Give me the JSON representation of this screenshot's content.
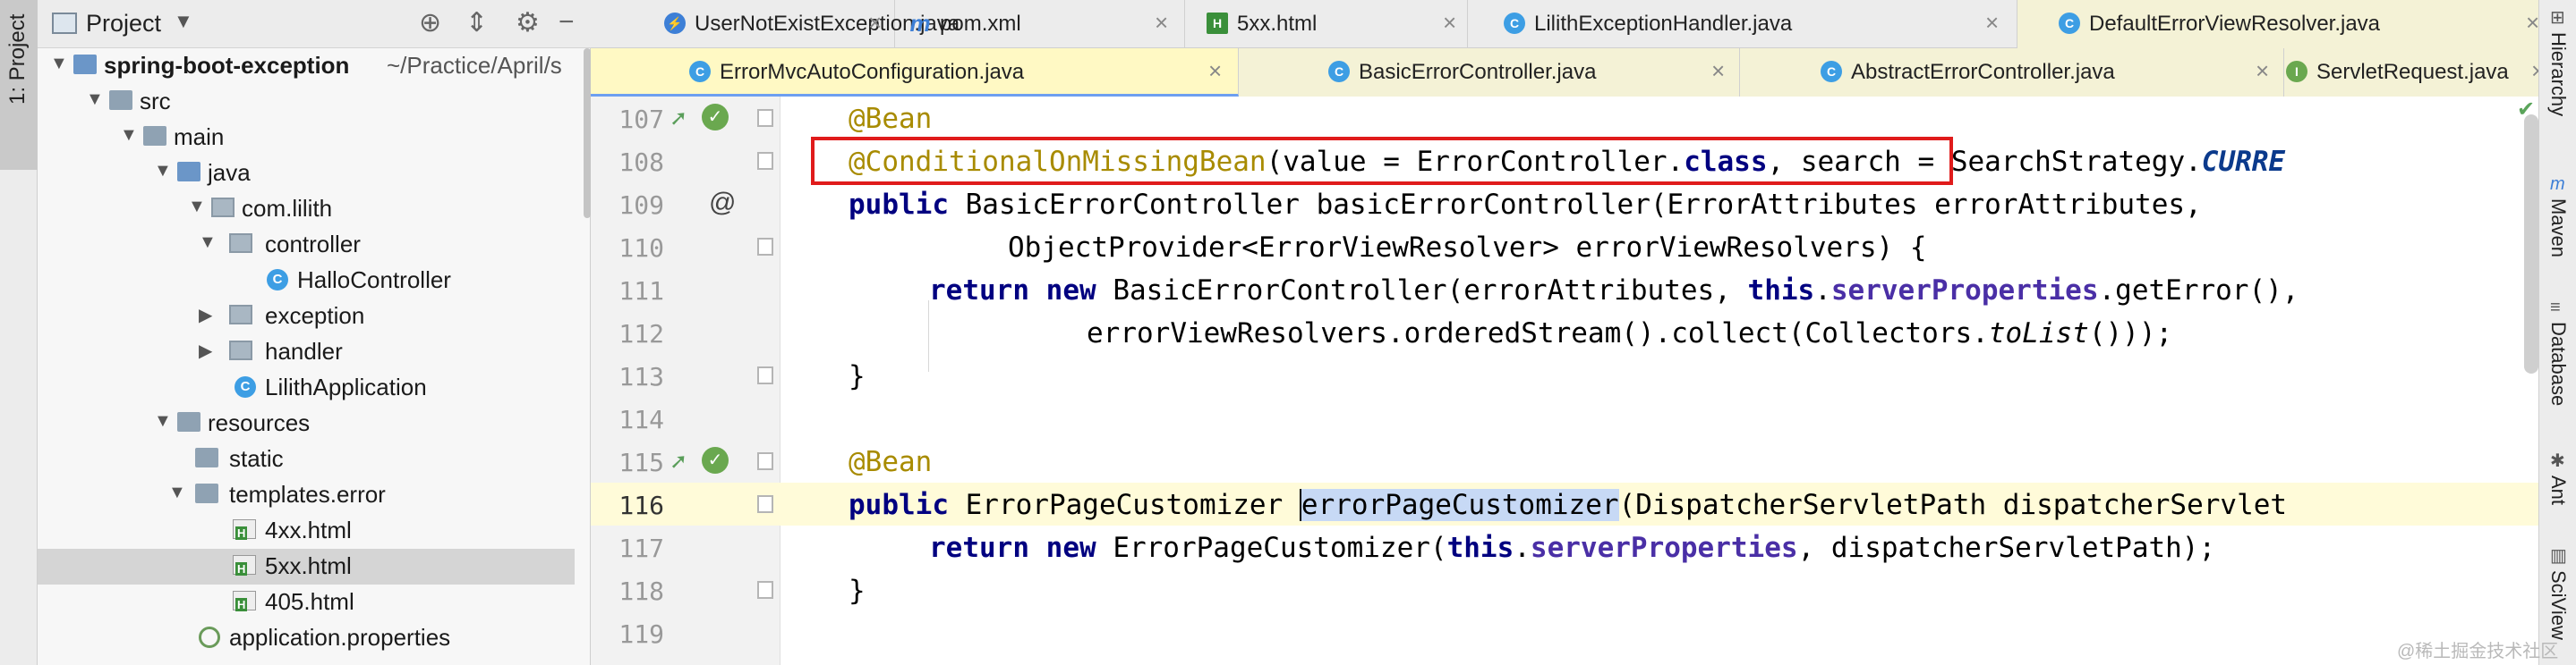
{
  "left_stripe": {
    "tab_label": "1: Project"
  },
  "project_panel": {
    "title": "Project",
    "tree": [
      {
        "label": "spring-boot-exception",
        "suffix": " ~/Practice/April/s",
        "bold": true
      },
      {
        "label": "src"
      },
      {
        "label": "main"
      },
      {
        "label": "java"
      },
      {
        "label": "com.lilith"
      },
      {
        "label": "controller"
      },
      {
        "label": "HalloController"
      },
      {
        "label": "exception"
      },
      {
        "label": "handler"
      },
      {
        "label": "LilithApplication"
      },
      {
        "label": "resources"
      },
      {
        "label": "static"
      },
      {
        "label": "templates.error"
      },
      {
        "label": "4xx.html"
      },
      {
        "label": "5xx.html"
      },
      {
        "label": "405.html"
      },
      {
        "label": "application.properties"
      }
    ]
  },
  "tabs_row1": [
    {
      "label": "UserNotExistException.java"
    },
    {
      "label": "pom.xml"
    },
    {
      "label": "5xx.html"
    },
    {
      "label": "LilithExceptionHandler.java"
    },
    {
      "label": "DefaultErrorViewResolver.java"
    }
  ],
  "tabs_row2": [
    {
      "label": "ErrorMvcAutoConfiguration.java"
    },
    {
      "label": "BasicErrorController.java"
    },
    {
      "label": "AbstractErrorController.java"
    },
    {
      "label": "ServletRequest.java"
    }
  ],
  "editor": {
    "line_numbers": [
      "107",
      "108",
      "109",
      "110",
      "111",
      "112",
      "113",
      "114",
      "115",
      "116",
      "117",
      "118",
      "119"
    ],
    "code": {
      "l107_ann": "@Bean",
      "l108_ann": "@ConditionalOnMissingBean",
      "l108_a": "(value = ErrorController.",
      "l108_kw": "class",
      "l108_b": ", search = SearchStrategy.",
      "l108_c": "CURRE",
      "l109_kw": "public",
      "l109_a": " BasicErrorController basicErrorController(ErrorAttributes errorAttributes,",
      "l110_a": "ObjectProvider<ErrorViewResolver> errorViewResolvers) {",
      "l111_kw1": "return",
      "l111_kw2": "new",
      "l111_a": " BasicErrorController(errorAttributes, ",
      "l111_kw3": "this",
      "l111_fld": "serverProperties",
      "l111_b": ".getError(),",
      "l112_a": "errorViewResolvers.orderedStream().collect(Collectors.",
      "l112_it": "toList",
      "l112_b": "()));",
      "l113_a": "}",
      "l115_ann": "@Bean",
      "l116_kw": "public",
      "l116_a": " ErrorPageCustomizer ",
      "l116_hl": "errorPageCustomizer",
      "l116_b": "(DispatcherServletPath dispatcherServlet",
      "l117_kw1": "return",
      "l117_kw2": "new",
      "l117_a": " ErrorPageCustomizer(",
      "l117_kw3": "this",
      "l117_fld": "serverProperties",
      "l117_b": ", dispatcherServletPath);",
      "l118_a": "}"
    }
  },
  "right_stripe": [
    {
      "label": "Hierarchy",
      "icon": "hierarchy-icon"
    },
    {
      "label": "Maven",
      "icon": "maven-icon"
    },
    {
      "label": "Database",
      "icon": "database-icon"
    },
    {
      "label": "Ant",
      "icon": "ant-icon"
    },
    {
      "label": "SciView",
      "icon": "sciview-icon"
    }
  ],
  "watermark": "@稀土掘金技术社区",
  "colors": {
    "highlight_box": "#e01b1b",
    "annotation": "#a88b00",
    "keyword": "#0b3a8c",
    "field": "#4a2fa6"
  }
}
